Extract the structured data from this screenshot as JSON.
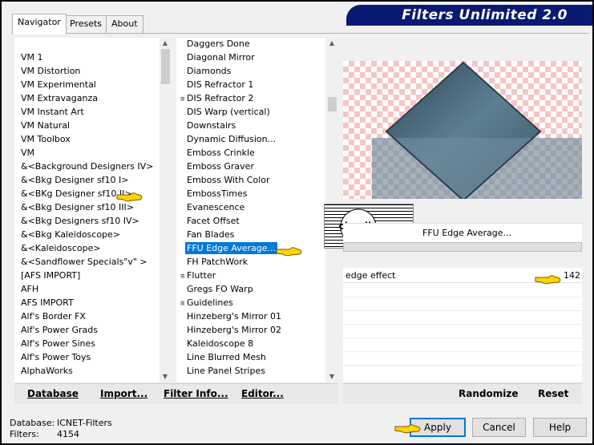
{
  "title": "Filters Unlimited 2.0",
  "tabs": [
    {
      "label": "Navigator",
      "active": true
    },
    {
      "label": "Presets",
      "active": false
    },
    {
      "label": "About",
      "active": false
    }
  ],
  "categories": [
    "VM 1",
    "VM Distortion",
    "VM Experimental",
    "VM Extravaganza",
    "VM Instant Art",
    "VM Natural",
    "VM Toolbox",
    "VM",
    "&<Background Designers IV>",
    "&<Bkg Designer sf10 I>",
    "&<BKg Designer sf10 II>",
    "&<Bkg Designer sf10 III>",
    "&<Bkg Designers sf10 IV>",
    "&<Bkg Kaleidoscope>",
    "&<Kaleidoscope>",
    "&<Sandflower Specials\"v\" >",
    "[AFS IMPORT]",
    "AFH",
    "AFS IMPORT",
    "Alf's Border FX",
    "Alf's Power Grads",
    "Alf's Power Sines",
    "Alf's Power Toys",
    "AlphaWorks"
  ],
  "selected_category": "&<BKg Designer sf10 II>",
  "filters": [
    {
      "label": "Daggers Done",
      "marked": false
    },
    {
      "label": "Diagonal Mirror",
      "marked": false
    },
    {
      "label": "Diamonds",
      "marked": false
    },
    {
      "label": "DIS Refractor 1",
      "marked": false
    },
    {
      "label": "DIS Refractor 2",
      "marked": true
    },
    {
      "label": "DIS Warp (vertical)",
      "marked": false
    },
    {
      "label": "Downstairs",
      "marked": false
    },
    {
      "label": "Dynamic Diffusion...",
      "marked": false
    },
    {
      "label": "Emboss Crinkle",
      "marked": false
    },
    {
      "label": "Emboss Graver",
      "marked": false
    },
    {
      "label": "Emboss With Color",
      "marked": false
    },
    {
      "label": "EmbossTimes",
      "marked": false
    },
    {
      "label": "Evanescence",
      "marked": false
    },
    {
      "label": "Facet Offset",
      "marked": false
    },
    {
      "label": "Fan Blades",
      "marked": false
    },
    {
      "label": "FFU Edge Average...",
      "marked": false,
      "selected": true
    },
    {
      "label": "FH PatchWork",
      "marked": false
    },
    {
      "label": "Flutter",
      "marked": true
    },
    {
      "label": "Gregs FO Warp",
      "marked": false
    },
    {
      "label": "Guidelines",
      "marked": true
    },
    {
      "label": "Hinzeberg's Mirror 01",
      "marked": false
    },
    {
      "label": "Hinzeberg's Mirror 02",
      "marked": false
    },
    {
      "label": "Kaleidoscope 8",
      "marked": false
    },
    {
      "label": "Line Blurred Mesh",
      "marked": false
    },
    {
      "label": "Line Panel Stripes",
      "marked": false
    }
  ],
  "filter_mark_glyph": "≡",
  "preview": {
    "filter_name": "FFU Edge Average...",
    "watermark": "claudia"
  },
  "params": [
    {
      "label": "edge effect",
      "value": "142"
    }
  ],
  "toolbar": {
    "database": "Database",
    "import": "Import...",
    "filter_info": "Filter Info...",
    "editor": "Editor..."
  },
  "right_buttons": {
    "randomize": "Randomize",
    "reset": "Reset"
  },
  "status": {
    "database_label": "Database:",
    "database_value": "ICNET-Filters",
    "filters_label": "Filters:",
    "filters_value": "4154"
  },
  "buttons": {
    "apply": "Apply",
    "cancel": "Cancel",
    "help": "Help"
  },
  "colors": {
    "accent": "#0078d7",
    "banner": "#0a1a72",
    "hand": "#ffd400"
  }
}
